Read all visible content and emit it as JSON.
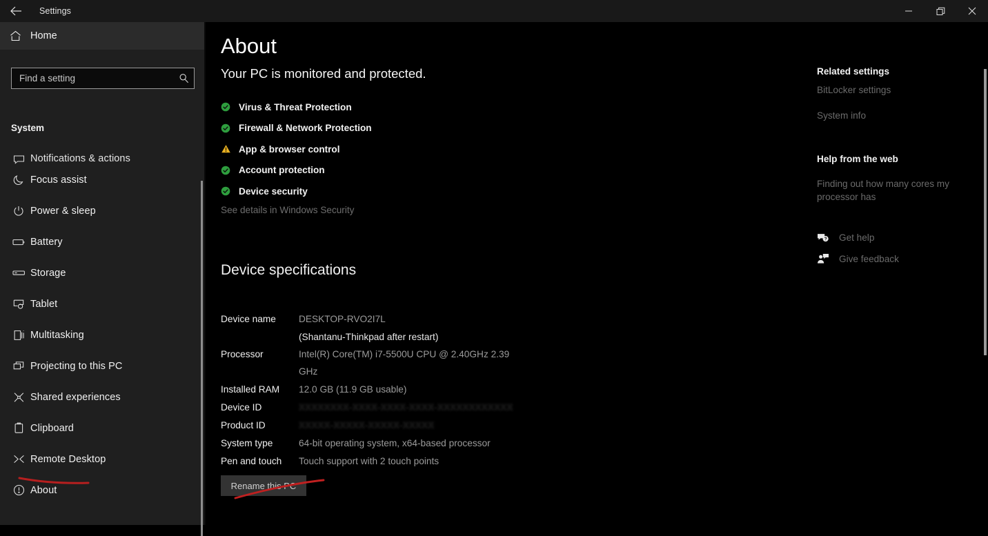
{
  "window": {
    "title": "Settings",
    "back_icon": "back-arrow-icon",
    "minimize_label": "–",
    "maximize_label": "❐",
    "close_label": "✕"
  },
  "sidebar": {
    "home_label": "Home",
    "home_icon": "home-icon",
    "search": {
      "placeholder": "Find a setting",
      "value": "",
      "icon": "search-icon"
    },
    "group_title": "System",
    "items": [
      {
        "label": "Notifications & actions",
        "icon": "notifications-icon",
        "selected": false
      },
      {
        "label": "Focus assist",
        "icon": "moon-icon",
        "selected": false
      },
      {
        "label": "Power & sleep",
        "icon": "power-icon",
        "selected": false
      },
      {
        "label": "Battery",
        "icon": "battery-icon",
        "selected": false
      },
      {
        "label": "Storage",
        "icon": "storage-icon",
        "selected": false
      },
      {
        "label": "Tablet",
        "icon": "tablet-icon",
        "selected": false
      },
      {
        "label": "Multitasking",
        "icon": "multitasking-icon",
        "selected": false
      },
      {
        "label": "Projecting to this PC",
        "icon": "projecting-icon",
        "selected": false
      },
      {
        "label": "Shared experiences",
        "icon": "shared-experiences-icon",
        "selected": false
      },
      {
        "label": "Clipboard",
        "icon": "clipboard-icon",
        "selected": false
      },
      {
        "label": "Remote Desktop",
        "icon": "remote-desktop-icon",
        "selected": false
      },
      {
        "label": "About",
        "icon": "info-icon",
        "selected": true
      }
    ]
  },
  "main": {
    "page_title": "About",
    "pc_status": "Your PC is monitored and protected.",
    "security_items": [
      {
        "label": "Virus & Threat Protection",
        "state": "ok"
      },
      {
        "label": "Firewall & Network Protection",
        "state": "ok"
      },
      {
        "label": "App & browser control",
        "state": "warning"
      },
      {
        "label": "Account protection",
        "state": "ok"
      },
      {
        "label": "Device security",
        "state": "ok"
      }
    ],
    "see_details_link": "See details in Windows Security",
    "device_specs_title": "Device specifications",
    "specs": [
      {
        "key": "Device name",
        "value": "DESKTOP-RVO2I7L",
        "sub": "(Shantanu-Thinkpad after restart)"
      },
      {
        "key": "Processor",
        "value": "Intel(R) Core(TM) i7-5500U CPU @ 2.40GHz   2.39 GHz"
      },
      {
        "key": "Installed RAM",
        "value": "12.0 GB (11.9 GB usable)"
      },
      {
        "key": "Device ID",
        "value": "XXXXXXXX-XXXX-XXXX-XXXX-XXXXXXXXXXXX",
        "redacted": true
      },
      {
        "key": "Product ID",
        "value": "XXXXX-XXXXX-XXXXX-XXXXX",
        "redacted": true
      },
      {
        "key": "System type",
        "value": "64-bit operating system, x64-based processor"
      },
      {
        "key": "Pen and touch",
        "value": "Touch support with 2 touch points"
      }
    ],
    "rename_button": "Rename this PC"
  },
  "right_rail": {
    "related_settings_title": "Related settings",
    "related_links": [
      "BitLocker settings",
      "System info"
    ],
    "help_title": "Help from the web",
    "help_links": [
      "Finding out how many cores my processor has"
    ],
    "actions": [
      {
        "label": "Get help",
        "icon": "question-bubble-icon"
      },
      {
        "label": "Give feedback",
        "icon": "feedback-person-icon"
      }
    ]
  },
  "colors": {
    "ok_green": "#2e9e3e",
    "warning_amber": "#e8b022",
    "annotation_red": "#b61f1f",
    "sidebar_bg": "#1f1f1f",
    "main_bg": "#000000"
  },
  "annotations": [
    {
      "name": "about-underline",
      "color": "#b61f1f"
    },
    {
      "name": "rename-button-strike",
      "color": "#c02020"
    }
  ]
}
